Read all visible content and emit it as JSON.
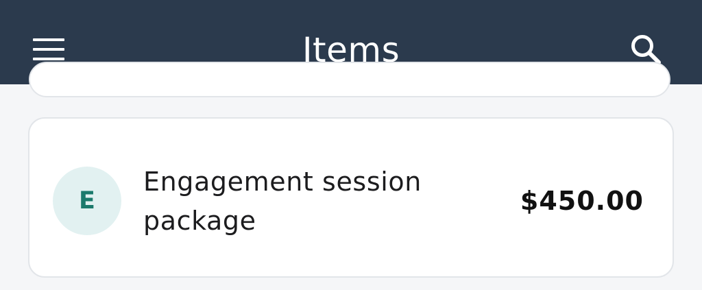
{
  "app_bar": {
    "title": "Items",
    "menu_icon": "hamburger-menu-icon",
    "search_icon": "search-icon",
    "background_color": "#2b3a4d"
  },
  "items": [
    {
      "avatar_letter": "E",
      "name": "Engagement session package",
      "price": "$450.00",
      "avatar_bg": "#e2f1f1",
      "avatar_fg": "#1b7a6c"
    }
  ]
}
